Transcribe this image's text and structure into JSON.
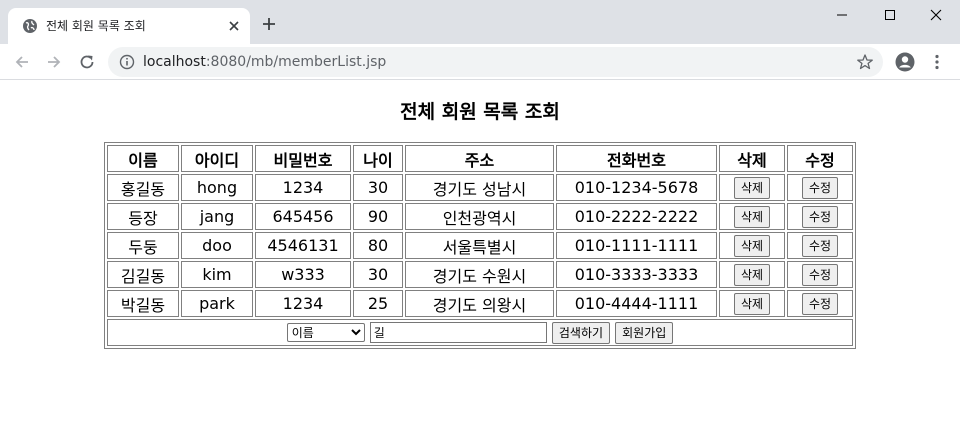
{
  "browser": {
    "tab_title": "전체 회원 목록 조회",
    "url_host": "localhost",
    "url_rest": ":8080/mb/memberList.jsp"
  },
  "page": {
    "title": "전체 회원 목록 조회"
  },
  "table": {
    "headers": [
      "이름",
      "아이디",
      "비밀번호",
      "나이",
      "주소",
      "전화번호",
      "삭제",
      "수정"
    ],
    "rows": [
      {
        "name": "홍길동",
        "id": "hong",
        "password": "1234",
        "age": "30",
        "address": "경기도 성남시",
        "phone": "010-1234-5678",
        "delete_label": "삭제",
        "edit_label": "수정"
      },
      {
        "name": "등장",
        "id": "jang",
        "password": "645456",
        "age": "90",
        "address": "인천광역시",
        "phone": "010-2222-2222",
        "delete_label": "삭제",
        "edit_label": "수정"
      },
      {
        "name": "두둥",
        "id": "doo",
        "password": "4546131",
        "age": "80",
        "address": "서울특별시",
        "phone": "010-1111-1111",
        "delete_label": "삭제",
        "edit_label": "수정"
      },
      {
        "name": "김길동",
        "id": "kim",
        "password": "w333",
        "age": "30",
        "address": "경기도 수원시",
        "phone": "010-3333-3333",
        "delete_label": "삭제",
        "edit_label": "수정"
      },
      {
        "name": "박길동",
        "id": "park",
        "password": "1234",
        "age": "25",
        "address": "경기도 의왕시",
        "phone": "010-4444-1111",
        "delete_label": "삭제",
        "edit_label": "수정"
      }
    ]
  },
  "search": {
    "selected_option": "이름",
    "query": "길",
    "search_label": "검색하기",
    "join_label": "회원가입"
  }
}
